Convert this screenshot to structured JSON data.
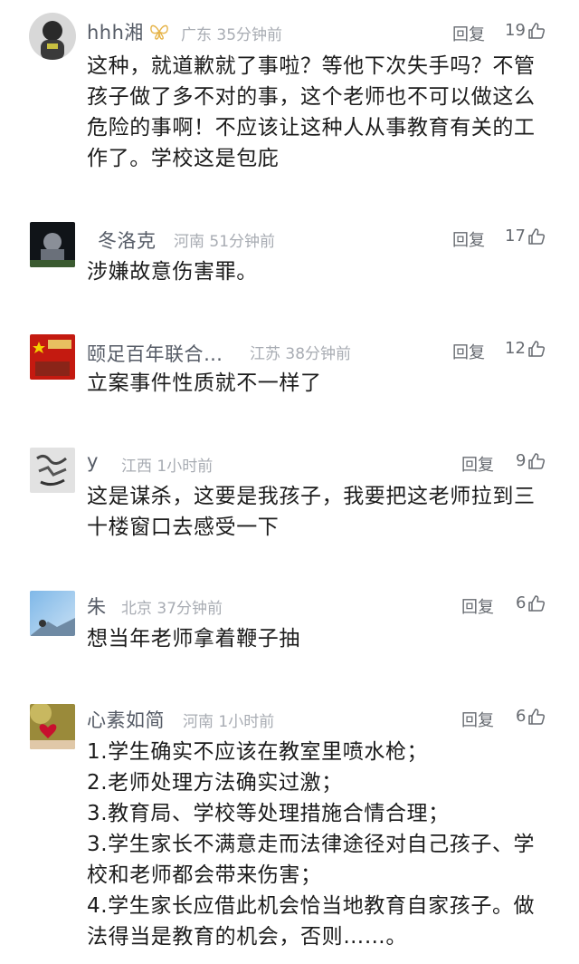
{
  "reply_label": "回复",
  "comments": [
    {
      "user": "hhh湘",
      "location": "广东",
      "time": "35分钟前",
      "likes": "19",
      "text": "这种，就道歉就了事啦？等他下次失手吗？不管\n孩子做了多不对的事，这个老师也不可以做这么\n危险的事啊！不应该让这种人从事教育有关的工\n作了。学校这是包庇"
    },
    {
      "user": "冬洛克",
      "location": "河南",
      "time": "51分钟前",
      "likes": "17",
      "text": "涉嫌故意伤害罪。"
    },
    {
      "user": "颐足百年联合…",
      "location": "江苏",
      "time": "38分钟前",
      "likes": "12",
      "text": "立案事件性质就不一样了"
    },
    {
      "user": "y",
      "location": "江西",
      "time": "1小时前",
      "likes": "9",
      "text": "这是谋杀，这要是我孩子，我要把这老师拉到三\n十楼窗口去感受一下"
    },
    {
      "user": "朱",
      "location": "北京",
      "time": "37分钟前",
      "likes": "6",
      "text": "想当年老师拿着鞭子抽"
    },
    {
      "user": "心素如简",
      "location": "河南",
      "time": "1小时前",
      "likes": "6",
      "text": "1.学生确实不应该在教室里喷水枪；\n2.老师处理方法确实过激；\n3.教育局、学校等处理措施合情合理；\n3.学生家长不满意走而法律途径对自己孩子、学\n校和老师都会带来伤害；\n4.学生家长应借此机会恰当地教育自家孩子。做\n法得当是教育的机会，否则……。"
    }
  ],
  "icons": {
    "like": "thumbs-up-icon",
    "badge": "butterfly-badge-icon"
  },
  "colors": {
    "name": "#555b66",
    "meta": "#a8acb3",
    "text": "#1c1c1c"
  }
}
